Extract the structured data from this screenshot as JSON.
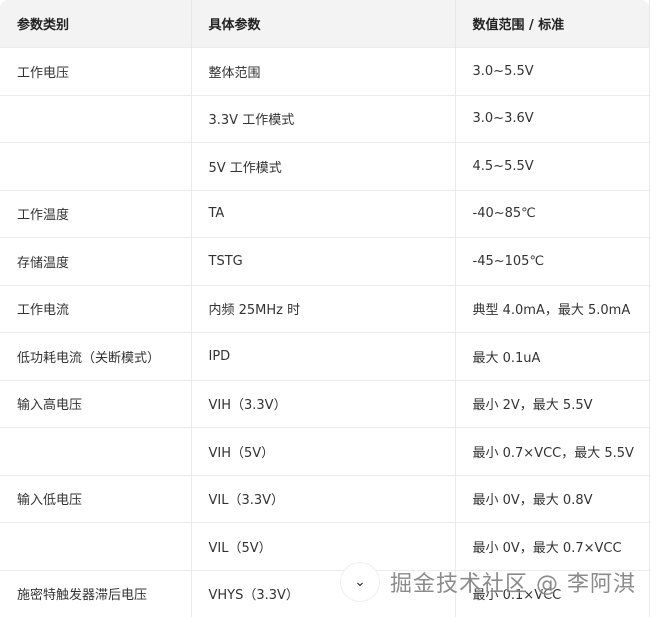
{
  "headers": [
    "参数类别",
    "具体参数",
    "数值范围 / 标准"
  ],
  "rows": [
    [
      "工作电压",
      "整体范围",
      "3.0~5.5V"
    ],
    [
      "",
      "3.3V 工作模式",
      "3.0~3.6V"
    ],
    [
      "",
      "5V 工作模式",
      "4.5~5.5V"
    ],
    [
      "工作温度",
      "TA",
      "-40~85℃"
    ],
    [
      "存储温度",
      "TSTG",
      "-45~105℃"
    ],
    [
      "工作电流",
      "内频 25MHz 时",
      "典型 4.0mA，最大 5.0mA"
    ],
    [
      "低功耗电流（关断模式）",
      "IPD",
      "最大 0.1uA"
    ],
    [
      "输入高电压",
      "VIH（3.3V）",
      "最小 2V，最大 5.5V"
    ],
    [
      "",
      "VIH（5V）",
      "最小 0.7×VCC，最大 5.5V"
    ],
    [
      "输入低电压",
      "VIL（3.3V）",
      "最小 0V，最大 0.8V"
    ],
    [
      "",
      "VIL（5V）",
      "最小 0V，最大 0.7×VCC"
    ],
    [
      "施密特触发器滞后电压",
      "VHYS（3.3V）",
      "最小 0.1×VCC"
    ]
  ],
  "watermark": "掘金技术社区 @ 李阿淇",
  "scroll_icon": "chevron-down-icon"
}
